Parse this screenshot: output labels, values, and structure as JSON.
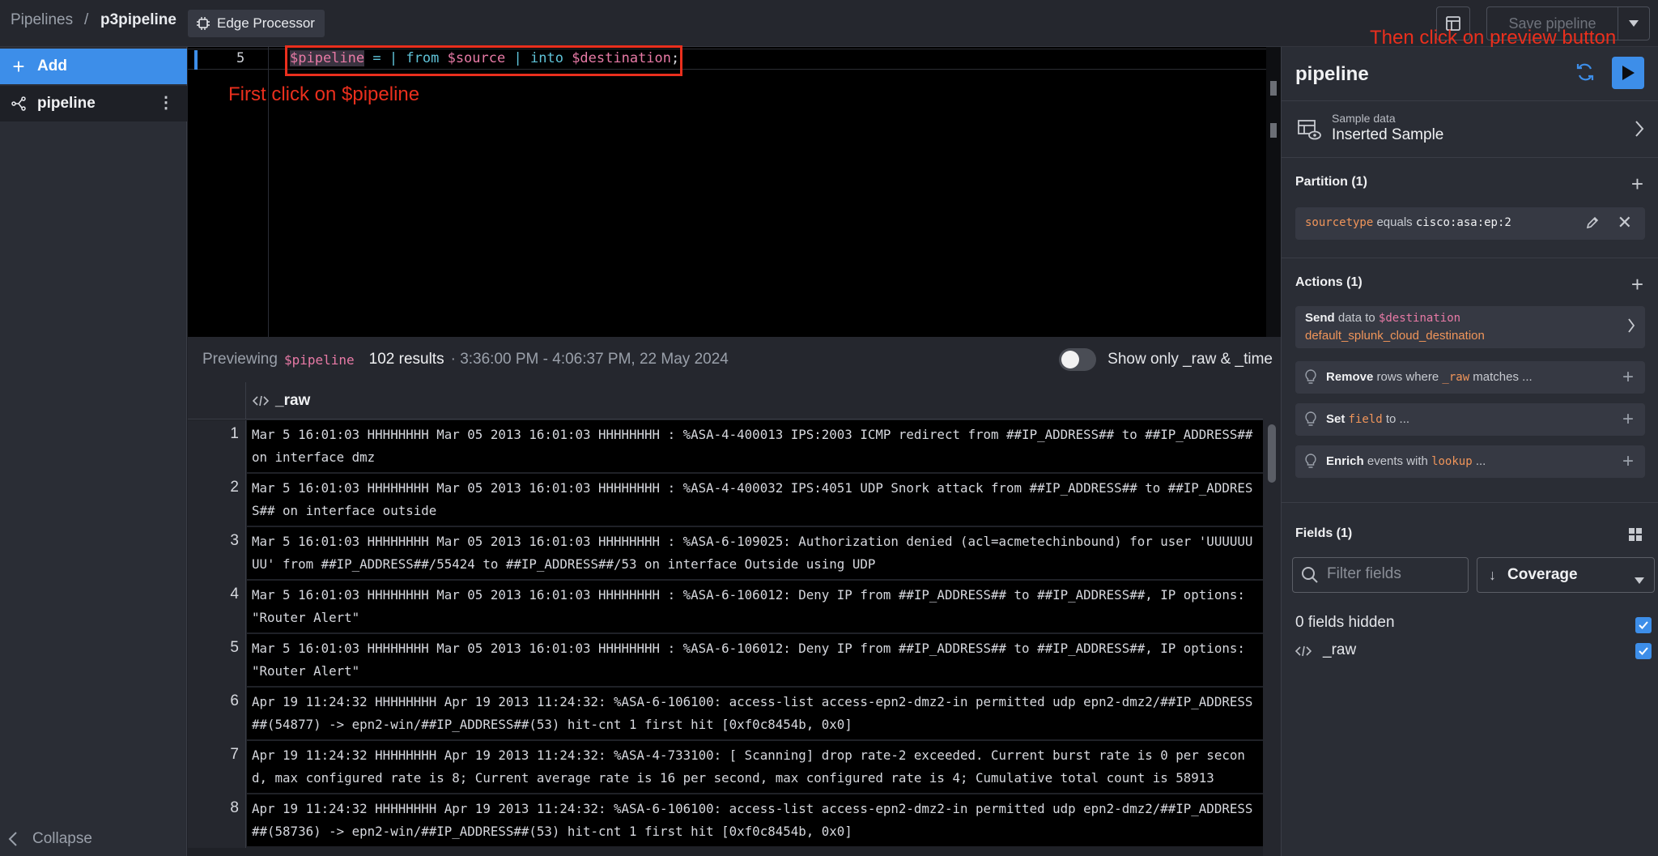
{
  "breadcrumb": {
    "root": "Pipelines",
    "separator": "/",
    "current": "p3pipeline"
  },
  "header": {
    "badge": "Edge Processor",
    "save_label": "Save pipeline"
  },
  "sidebar": {
    "add_label": "Add",
    "pipeline_label": "pipeline",
    "collapse_label": "Collapse"
  },
  "editor": {
    "line_number": "5",
    "code": {
      "var": "$pipeline",
      "eq": "=",
      "pipe1": "|",
      "from": "from",
      "source": "$source",
      "pipe2": "|",
      "into": "into",
      "destination": "$destination",
      "semi": ";"
    }
  },
  "annotations": {
    "first": "First click on $pipeline",
    "second": "Then click on preview button"
  },
  "preview": {
    "label": "Previewing",
    "pipeline": "$pipeline",
    "count": "102 results",
    "range": "· 3:36:00 PM - 4:06:37 PM, 22 May 2024",
    "toggle_label": "Show only _raw & _time",
    "toggle_on": false
  },
  "table": {
    "column": "_raw",
    "rows": [
      {
        "n": "1",
        "raw": "Mar 5 16:01:03 HHHHHHHH Mar 05 2013 16:01:03 HHHHHHHH : %ASA-4-400013 IPS:2003 ICMP redirect from ##IP_ADDRESS## to ##IP_ADDRESS## on interface dmz"
      },
      {
        "n": "2",
        "raw": "Mar 5 16:01:03 HHHHHHHH Mar 05 2013 16:01:03 HHHHHHHH : %ASA-4-400032 IPS:4051 UDP Snork attack from ##IP_ADDRESS## to ##IP_ADDRESS## on interface outside"
      },
      {
        "n": "3",
        "raw": "Mar 5 16:01:03 HHHHHHHH Mar 05 2013 16:01:03 HHHHHHHH : %ASA-6-109025: Authorization denied (acl=acmetechinbound) for user 'UUUUUUUU' from ##IP_ADDRESS##/55424 to ##IP_ADDRESS##/53 on interface Outside using UDP"
      },
      {
        "n": "4",
        "raw": "Mar 5 16:01:03 HHHHHHHH Mar 05 2013 16:01:03 HHHHHHHH : %ASA-6-106012: Deny IP from ##IP_ADDRESS## to ##IP_ADDRESS##, IP options: \"Router Alert\""
      },
      {
        "n": "5",
        "raw": "Mar 5 16:01:03 HHHHHHHH Mar 05 2013 16:01:03 HHHHHHHH : %ASA-6-106012: Deny IP from ##IP_ADDRESS## to ##IP_ADDRESS##, IP options: \"Router Alert\""
      },
      {
        "n": "6",
        "raw": "Apr 19 11:24:32 HHHHHHHH Apr 19 2013 11:24:32: %ASA-6-106100: access-list access-epn2-dmz2-in permitted udp epn2-dmz2/##IP_ADDRESS##(54877) -> epn2-win/##IP_ADDRESS##(53) hit-cnt 1 first hit [0xf0c8454b, 0x0]"
      },
      {
        "n": "7",
        "raw": "Apr 19 11:24:32 HHHHHHHH Apr 19 2013 11:24:32: %ASA-4-733100: [ Scanning] drop rate-2 exceeded. Current burst rate is 0 per second, max configured rate is 8; Current average rate is 16 per second, max configured rate is 4; Cumulative total count is 58913"
      },
      {
        "n": "8",
        "raw": "Apr 19 11:24:32 HHHHHHHH Apr 19 2013 11:24:32: %ASA-6-106100: access-list access-epn2-dmz2-in permitted udp epn2-dmz2/##IP_ADDRESS##(58736) -> epn2-win/##IP_ADDRESS##(53) hit-cnt 1 first hit [0xf0c8454b, 0x0]"
      }
    ]
  },
  "panel": {
    "title": "pipeline",
    "sample": {
      "label": "Sample data",
      "value": "Inserted Sample"
    },
    "partition": {
      "title": "Partition (1)",
      "field": "sourcetype",
      "op": "equals",
      "value": "cisco:asa:ep:2"
    },
    "actions": {
      "title": "Actions (1)",
      "send": {
        "bold": "Send",
        "text": "data to",
        "var": "$destination",
        "dest": "default_splunk_cloud_destination"
      },
      "suggestions": [
        {
          "bold": "Remove",
          "pre": "rows where",
          "code": "_raw",
          "post": "matches ..."
        },
        {
          "bold": "Set",
          "pre": "",
          "code": "field",
          "post": "to ..."
        },
        {
          "bold": "Enrich",
          "pre": "events with",
          "code": "lookup",
          "post": "..."
        }
      ]
    },
    "fields": {
      "title": "Fields (1)",
      "filter_placeholder": "Filter fields",
      "sort_label": "Coverage",
      "hidden_label": "0 fields hidden",
      "items": [
        "_raw"
      ]
    }
  },
  "colors": {
    "accent": "#3d8ee9",
    "annotation": "#ea2f1d",
    "variable": "#e87aa6",
    "keyword": "#5fc3d8",
    "literal": "#f0955a"
  }
}
